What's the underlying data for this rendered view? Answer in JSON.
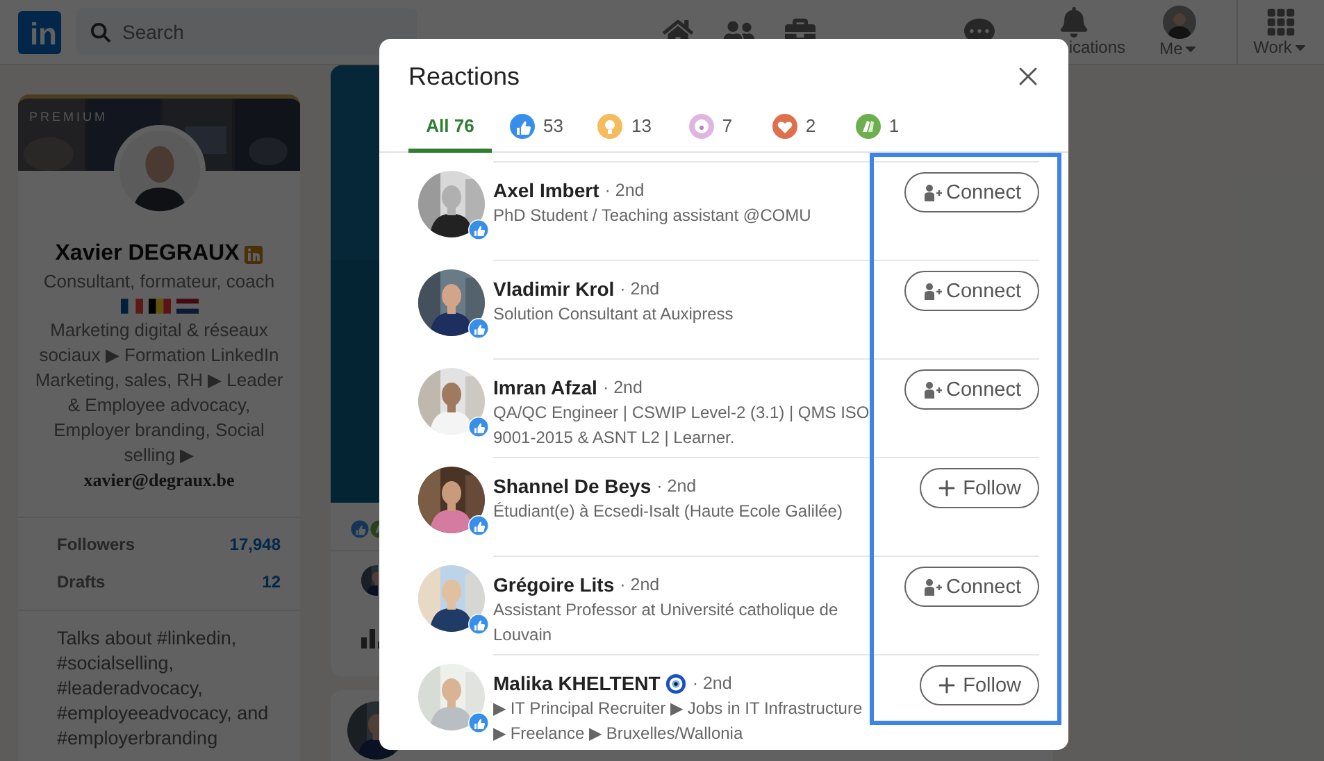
{
  "nav": {
    "logo": "in",
    "search": {
      "placeholder": "Search"
    },
    "items": [
      {
        "kind": "home"
      },
      {
        "kind": "network"
      },
      {
        "kind": "jobs"
      },
      {
        "kind": "messaging"
      },
      {
        "kind": "notifications",
        "label": "ications"
      },
      {
        "kind": "me",
        "label": "Me",
        "dropdown": true
      },
      {
        "kind": "work",
        "label": "Work",
        "dropdown": true
      }
    ]
  },
  "profile": {
    "premium_label": "PREMIUM",
    "name": "Xavier DEGRAUX",
    "premium_badge": true,
    "bio_start": "Consultant, formateur, coach",
    "flags": [
      {
        "kind": "fr"
      },
      {
        "kind": "be"
      },
      {
        "kind": "nl"
      }
    ],
    "bio_end": "Marketing digital & réseaux sociaux ▶ Formation LinkedIn Marketing, sales, RH ▶ Leader & Employee advocacy, Employer branding, Social selling ▶",
    "email": "xavier@degraux.be",
    "stats": [
      {
        "label": "Followers",
        "value": "17,948"
      },
      {
        "label": "Drafts",
        "value": "12"
      }
    ],
    "talks_about": "Talks about #linkedin, #socialselling, #leaderadvocacy, #employeeadvocacy, and #employerbranding"
  },
  "modal": {
    "title": "Reactions",
    "tabs": [
      {
        "kind": "all",
        "label": "All 76",
        "selected": true
      },
      {
        "kind": "like",
        "label": "53",
        "selected": false
      },
      {
        "kind": "insightful",
        "label": "13",
        "selected": false
      },
      {
        "kind": "curious",
        "label": "7",
        "selected": false
      },
      {
        "kind": "love",
        "label": "2",
        "selected": false
      },
      {
        "kind": "celebrate",
        "label": "1",
        "selected": false
      }
    ],
    "people": [
      {
        "name": "Axel Imbert",
        "degree": "· 2nd",
        "headline": "PhD Student / Teaching assistant @COMU",
        "reaction": {
          "kind": "like"
        },
        "action": {
          "kind": "connect",
          "label": "Connect"
        }
      },
      {
        "name": "Vladimir Krol",
        "degree": "· 2nd",
        "headline": "Solution Consultant at Auxipress",
        "reaction": {
          "kind": "like"
        },
        "action": {
          "kind": "connect",
          "label": "Connect"
        }
      },
      {
        "name": "Imran Afzal",
        "degree": "· 2nd",
        "headline": "QA/QC Engineer | CSWIP Level-2 (3.1) | QMS ISO 9001-2015 & ASNT L2 | Learner.",
        "reaction": {
          "kind": "like"
        },
        "action": {
          "kind": "connect",
          "label": "Connect"
        }
      },
      {
        "name": "Shannel De Beys",
        "degree": "· 2nd",
        "headline": "Étudiant(e) à Ecsedi-Isalt (Haute Ecole Galilée)",
        "reaction": {
          "kind": "like"
        },
        "action": {
          "kind": "follow",
          "label": "Follow"
        }
      },
      {
        "name": "Grégoire Lits",
        "degree": "· 2nd",
        "headline": "Assistant Professor at Université catholique de Louvain",
        "reaction": {
          "kind": "like"
        },
        "action": {
          "kind": "connect",
          "label": "Connect"
        }
      },
      {
        "name": "Malika KHELTENT",
        "name_emoji": true,
        "degree": "· 2nd",
        "headline": "▶ IT Principal Recruiter ▶ Jobs in IT Infrastructure ▶ Freelance ▶ Bruxelles/Wallonia",
        "reaction": {
          "kind": "like"
        },
        "action": {
          "kind": "follow",
          "label": "Follow"
        }
      }
    ]
  }
}
